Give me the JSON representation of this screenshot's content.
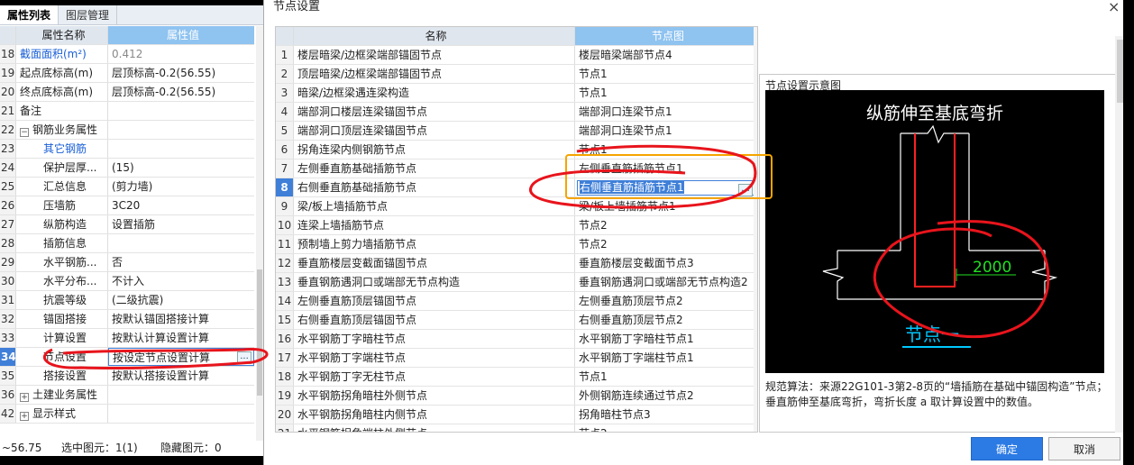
{
  "panel": {
    "tabs": [
      "属性列表",
      "图层管理"
    ],
    "header": {
      "name": "属性名称",
      "value": "属性值"
    },
    "rows": [
      {
        "no": "18",
        "name": "截面面积(m²)",
        "value": "0.412"
      },
      {
        "no": "19",
        "name": "起点底标高(m)",
        "value": "层顶标高-0.2(56.55)"
      },
      {
        "no": "20",
        "name": "终点底标高(m)",
        "value": "层顶标高-0.2(56.55)"
      },
      {
        "no": "21",
        "name": "备注",
        "value": ""
      },
      {
        "no": "22",
        "name": "钢筋业务属性",
        "value": "",
        "expander": "−"
      },
      {
        "no": "23",
        "name": "其它钢筋",
        "value": ""
      },
      {
        "no": "24",
        "name": "保护层厚...",
        "value": "(15)"
      },
      {
        "no": "25",
        "name": "汇总信息",
        "value": "(剪力墙)"
      },
      {
        "no": "26",
        "name": "压墙筋",
        "value": "3C20"
      },
      {
        "no": "27",
        "name": "纵筋构造",
        "value": "设置插筋"
      },
      {
        "no": "28",
        "name": "插筋信息",
        "value": ""
      },
      {
        "no": "29",
        "name": "水平钢筋...",
        "value": "否"
      },
      {
        "no": "30",
        "name": "水平分布...",
        "value": "不计入"
      },
      {
        "no": "31",
        "name": "抗震等级",
        "value": "(二级抗震)"
      },
      {
        "no": "32",
        "name": "锚固搭接",
        "value": "按默认锚固搭接计算"
      },
      {
        "no": "33",
        "name": "计算设置",
        "value": "按默认计算设置计算"
      },
      {
        "no": "34",
        "name": "节点设置",
        "value": "按设定节点设置计算"
      },
      {
        "no": "35",
        "name": "搭接设置",
        "value": "按默认搭接设置计算"
      },
      {
        "no": "36",
        "name": "土建业务属性",
        "value": "",
        "expander": "+"
      },
      {
        "no": "42",
        "name": "显示样式",
        "value": "",
        "expander": "+"
      }
    ],
    "ellipsis": "...",
    "status": {
      "coord": "~56.75",
      "selected": "选中图元：1(1)",
      "hidden": "隐藏图元：0"
    }
  },
  "dialog": {
    "title": "节点设置",
    "close": "×",
    "header": {
      "name": "名称",
      "node": "节点图"
    },
    "rows": [
      {
        "no": "1",
        "name": "楼层暗梁/边框梁端部锚固节点",
        "node": "楼层暗梁端部节点4"
      },
      {
        "no": "2",
        "name": "顶层暗梁/边框梁端部锚固节点",
        "node": "节点1"
      },
      {
        "no": "3",
        "name": "暗梁/边框梁遇连梁构造",
        "node": "节点1"
      },
      {
        "no": "4",
        "name": "端部洞口楼层连梁锚固节点",
        "node": "端部洞口连梁节点1"
      },
      {
        "no": "5",
        "name": "端部洞口顶层连梁锚固节点",
        "node": "端部洞口连梁节点1"
      },
      {
        "no": "6",
        "name": "拐角连梁内侧钢筋节点",
        "node": "节点1"
      },
      {
        "no": "7",
        "name": "左侧垂直筋基础插筋节点",
        "node": "左侧垂直筋插筋节点1"
      },
      {
        "no": "8",
        "name": "右侧垂直筋基础插筋节点",
        "node": "右侧垂直筋插筋节点1"
      },
      {
        "no": "9",
        "name": "梁/板上墙插筋节点",
        "node": "梁/板上墙插筋节点1"
      },
      {
        "no": "10",
        "name": "连梁上墙插筋节点",
        "node": "节点2"
      },
      {
        "no": "11",
        "name": "预制墙上剪力墙插筋节点",
        "node": "节点2"
      },
      {
        "no": "12",
        "name": "垂直筋楼层变截面锚固节点",
        "node": "垂直筋楼层变截面节点3"
      },
      {
        "no": "13",
        "name": "垂直钢筋遇洞口或端部无节点构造",
        "node": "垂直钢筋遇洞口或端部无节点构造2"
      },
      {
        "no": "14",
        "name": "左侧垂直筋顶层锚固节点",
        "node": "左侧垂直筋顶层节点2"
      },
      {
        "no": "15",
        "name": "右侧垂直筋顶层锚固节点",
        "node": "右侧垂直筋顶层节点2"
      },
      {
        "no": "16",
        "name": "水平钢筋丁字暗柱节点",
        "node": "水平钢筋丁字暗柱节点1"
      },
      {
        "no": "17",
        "name": "水平钢筋丁字端柱节点",
        "node": "水平钢筋丁字端柱节点1"
      },
      {
        "no": "18",
        "name": "水平钢筋丁字无柱节点",
        "node": "节点1"
      },
      {
        "no": "19",
        "name": "水平钢筋拐角暗柱外侧节点",
        "node": "外侧钢筋连续通过节点2"
      },
      {
        "no": "20",
        "name": "水平钢筋拐角暗柱内侧节点",
        "node": "拐角暗柱节点3"
      },
      {
        "no": "21",
        "name": "水平钢筋拐角端柱外侧节点",
        "node": "节点2"
      }
    ],
    "ellipsis": "...",
    "preview": {
      "title": "节点设置示意图",
      "diagram_title": "纵筋伸至基底弯折",
      "dimension": "2000",
      "node_label": "节点一",
      "description": "规范算法：来源22G101-3第2-8页的“墙插筋在基础中锚固构造”节点；垂直筋伸至基底弯折，弯折长度 a 取计算设置中的数值。"
    },
    "ok": "确定",
    "cancel": "取消"
  },
  "colors": {
    "accent": "#2c7be5",
    "header": "#8fc3f0",
    "annotation_red": "#e8141c",
    "annotation_orange": "#f5a400"
  }
}
